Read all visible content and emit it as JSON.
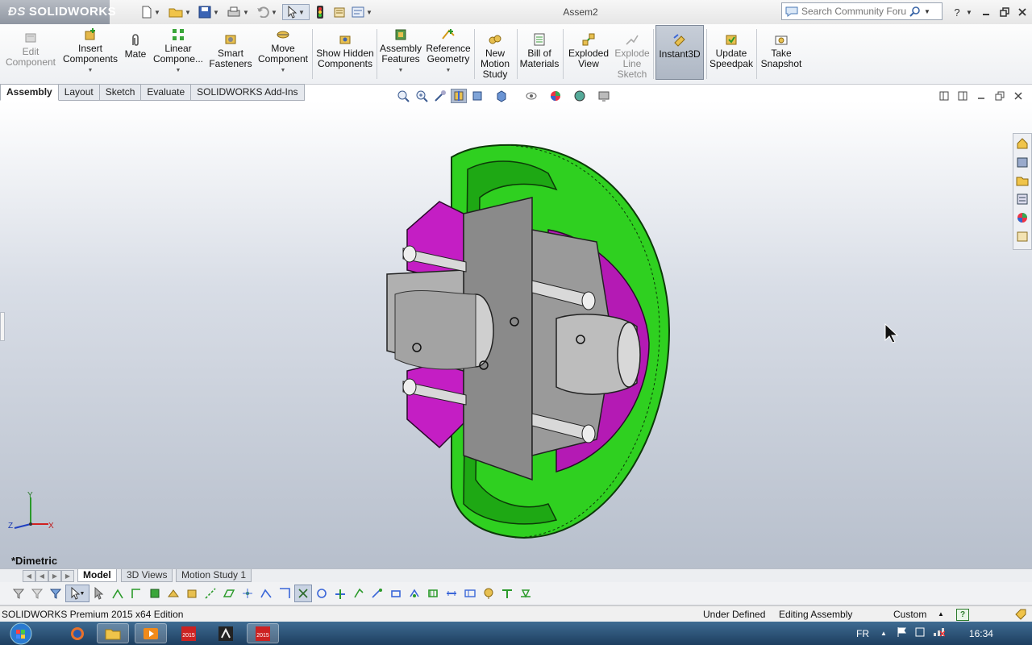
{
  "app": {
    "logo_text": "SOLIDWORKS",
    "document_title": "Assem2"
  },
  "search": {
    "placeholder": "Search Community Forum"
  },
  "command_manager": {
    "edit_component": "Edit Component",
    "insert_components": "Insert Components",
    "mate": "Mate",
    "linear_component": "Linear Compone...",
    "smart_fasteners": "Smart Fasteners",
    "move_component": "Move Component",
    "show_hidden": "Show Hidden Components",
    "assembly_features": "Assembly Features",
    "reference_geometry": "Reference Geometry",
    "new_motion_study": "New Motion Study",
    "bill_of_materials": "Bill of Materials",
    "exploded_view": "Exploded View",
    "explode_line_sketch": "Explode Line Sketch",
    "instant3d": "Instant3D",
    "update_speedpak": "Update Speedpak",
    "take_snapshot": "Take Snapshot"
  },
  "tabs": [
    {
      "label": "Assembly",
      "active": true
    },
    {
      "label": "Layout",
      "active": false
    },
    {
      "label": "Sketch",
      "active": false
    },
    {
      "label": "Evaluate",
      "active": false
    },
    {
      "label": "SOLIDWORKS Add-Ins",
      "active": false
    }
  ],
  "viewport": {
    "view_name": "*Dimetric",
    "triad": {
      "x": "X",
      "y": "Y",
      "z": "Z"
    }
  },
  "bottom_tabs": [
    {
      "label": "Model",
      "active": true
    },
    {
      "label": "3D Views",
      "active": false
    },
    {
      "label": "Motion Study 1",
      "active": false
    }
  ],
  "status": {
    "product": "SOLIDWORKS Premium 2015 x64 Edition",
    "definition": "Under Defined",
    "mode": "Editing Assembly",
    "units": "Custom"
  },
  "taskbar": {
    "language": "FR",
    "time": "16:34"
  },
  "colors": {
    "part_green": "#27c21b",
    "part_magenta": "#c41ec4",
    "part_gray": "#9a9a9a"
  }
}
